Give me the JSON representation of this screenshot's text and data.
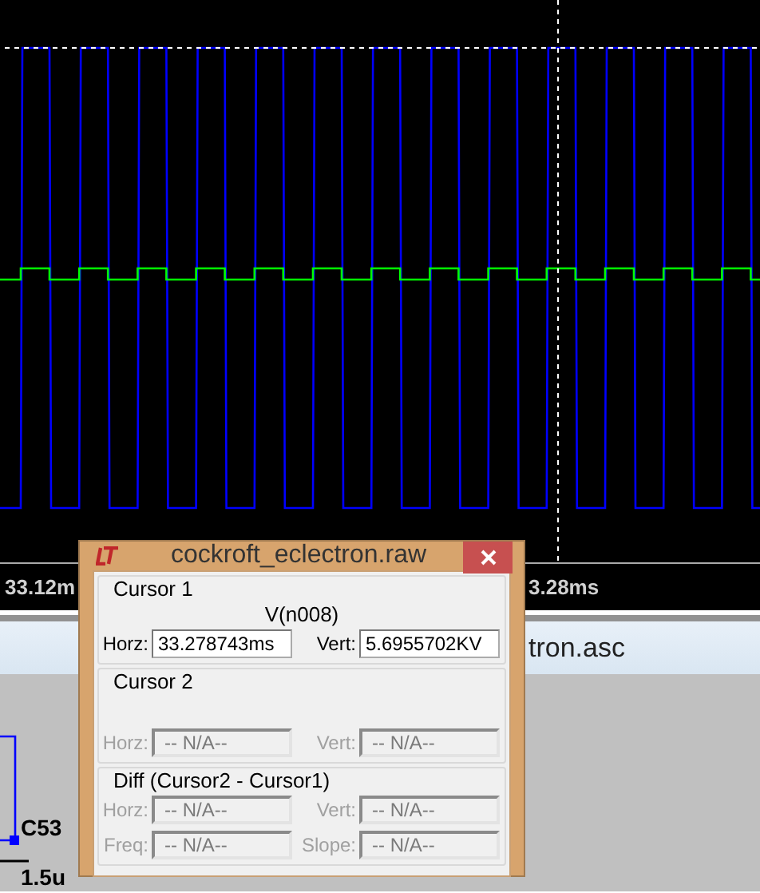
{
  "plot": {
    "x_labels": [
      "33.12m",
      "3.28ms"
    ]
  },
  "schematic_tab": {
    "title": "tron.asc"
  },
  "schematic": {
    "labels": [
      "C53",
      "1.5u"
    ]
  },
  "dialog": {
    "title": "cockroft_eclectron.raw",
    "groups": [
      {
        "label": "Cursor 1",
        "trace": "V(n008)",
        "fields": [
          {
            "label": "Horz:",
            "value": "33.278743ms",
            "disabled": false
          },
          {
            "label": "Vert:",
            "value": "5.6955702KV",
            "disabled": false
          }
        ]
      },
      {
        "label": "Cursor 2",
        "fields": [
          {
            "label": "Horz:",
            "value": "-- N/A--",
            "disabled": true
          },
          {
            "label": "Vert:",
            "value": "-- N/A--",
            "disabled": true
          }
        ]
      },
      {
        "label": "Diff (Cursor2 - Cursor1)",
        "fields": [
          {
            "label": "Horz:",
            "value": "-- N/A--",
            "disabled": true
          },
          {
            "label": "Vert:",
            "value": "-- N/A--",
            "disabled": true
          },
          {
            "label": "Freq:",
            "value": "-- N/A--",
            "disabled": true
          },
          {
            "label": "Slope:",
            "value": "-- N/A--",
            "disabled": true
          }
        ]
      }
    ]
  }
}
